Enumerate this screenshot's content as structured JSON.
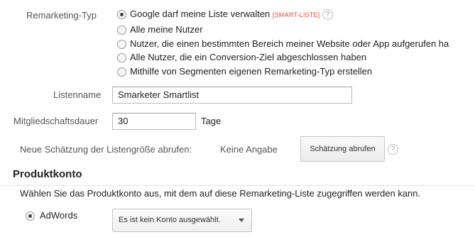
{
  "remarketing": {
    "label": "Remarketing-Typ",
    "options": [
      {
        "label": "Google darf meine Liste verwalten",
        "checked": true
      },
      {
        "label": "Alle meine Nutzer",
        "checked": false
      },
      {
        "label": "Nutzer, die einen bestimmten Bereich meiner Website oder App aufgerufen ha",
        "checked": false
      },
      {
        "label": "Alle Nutzer, die ein Conversion-Ziel abgeschlossen haben",
        "checked": false
      },
      {
        "label": "Mithilfe von Segmenten eigenen Remarketing-Typ erstellen",
        "checked": false
      }
    ],
    "smart_tag": "[SMART-LISTE]",
    "help_glyph": "?"
  },
  "listname": {
    "label": "Listenname",
    "value": "Smarketer Smartlist"
  },
  "membership": {
    "label": "Mitgliedschaftsdauer",
    "value": "30",
    "unit": "Tage"
  },
  "estimate": {
    "label": "Neue Schätzung der Listengröße abrufen:",
    "value": "Keine Angabe",
    "button": "Schätzung abrufen",
    "help_glyph": "?"
  },
  "produktkonto": {
    "title": "Produktkonto",
    "description": "Wählen Sie das Produktkonto aus, mit dem auf diese Remarketing-Liste zugegriffen werden kann.",
    "adwords_label": "AdWords",
    "adwords_checked": true,
    "select_value": "Es ist kein Konto ausgewählt."
  }
}
